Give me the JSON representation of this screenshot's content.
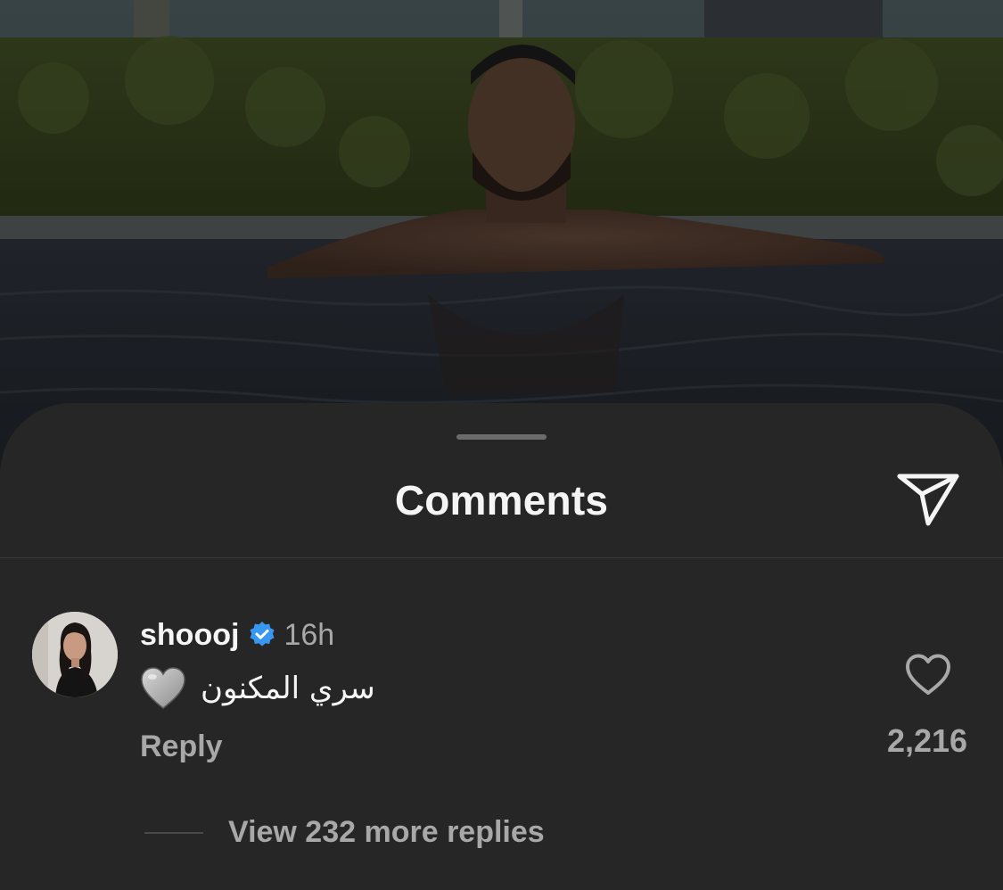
{
  "sheet": {
    "title": "Comments",
    "share_icon": "paper-plane-icon"
  },
  "comment": {
    "username": "shoooj",
    "verified_icon": "verified-badge-icon",
    "time": "16h",
    "emoji_icon": "grey-heart-emoji",
    "text": "سري المكنون",
    "reply_label": "Reply",
    "like_icon": "heart-outline-icon",
    "like_count": "2,216",
    "view_replies_label": "View 232 more replies"
  },
  "colors": {
    "sheet_background": "#262626",
    "primary_text": "#f5f5f5",
    "secondary_text": "#a8a8a8",
    "verified_blue": "#3897f0"
  }
}
